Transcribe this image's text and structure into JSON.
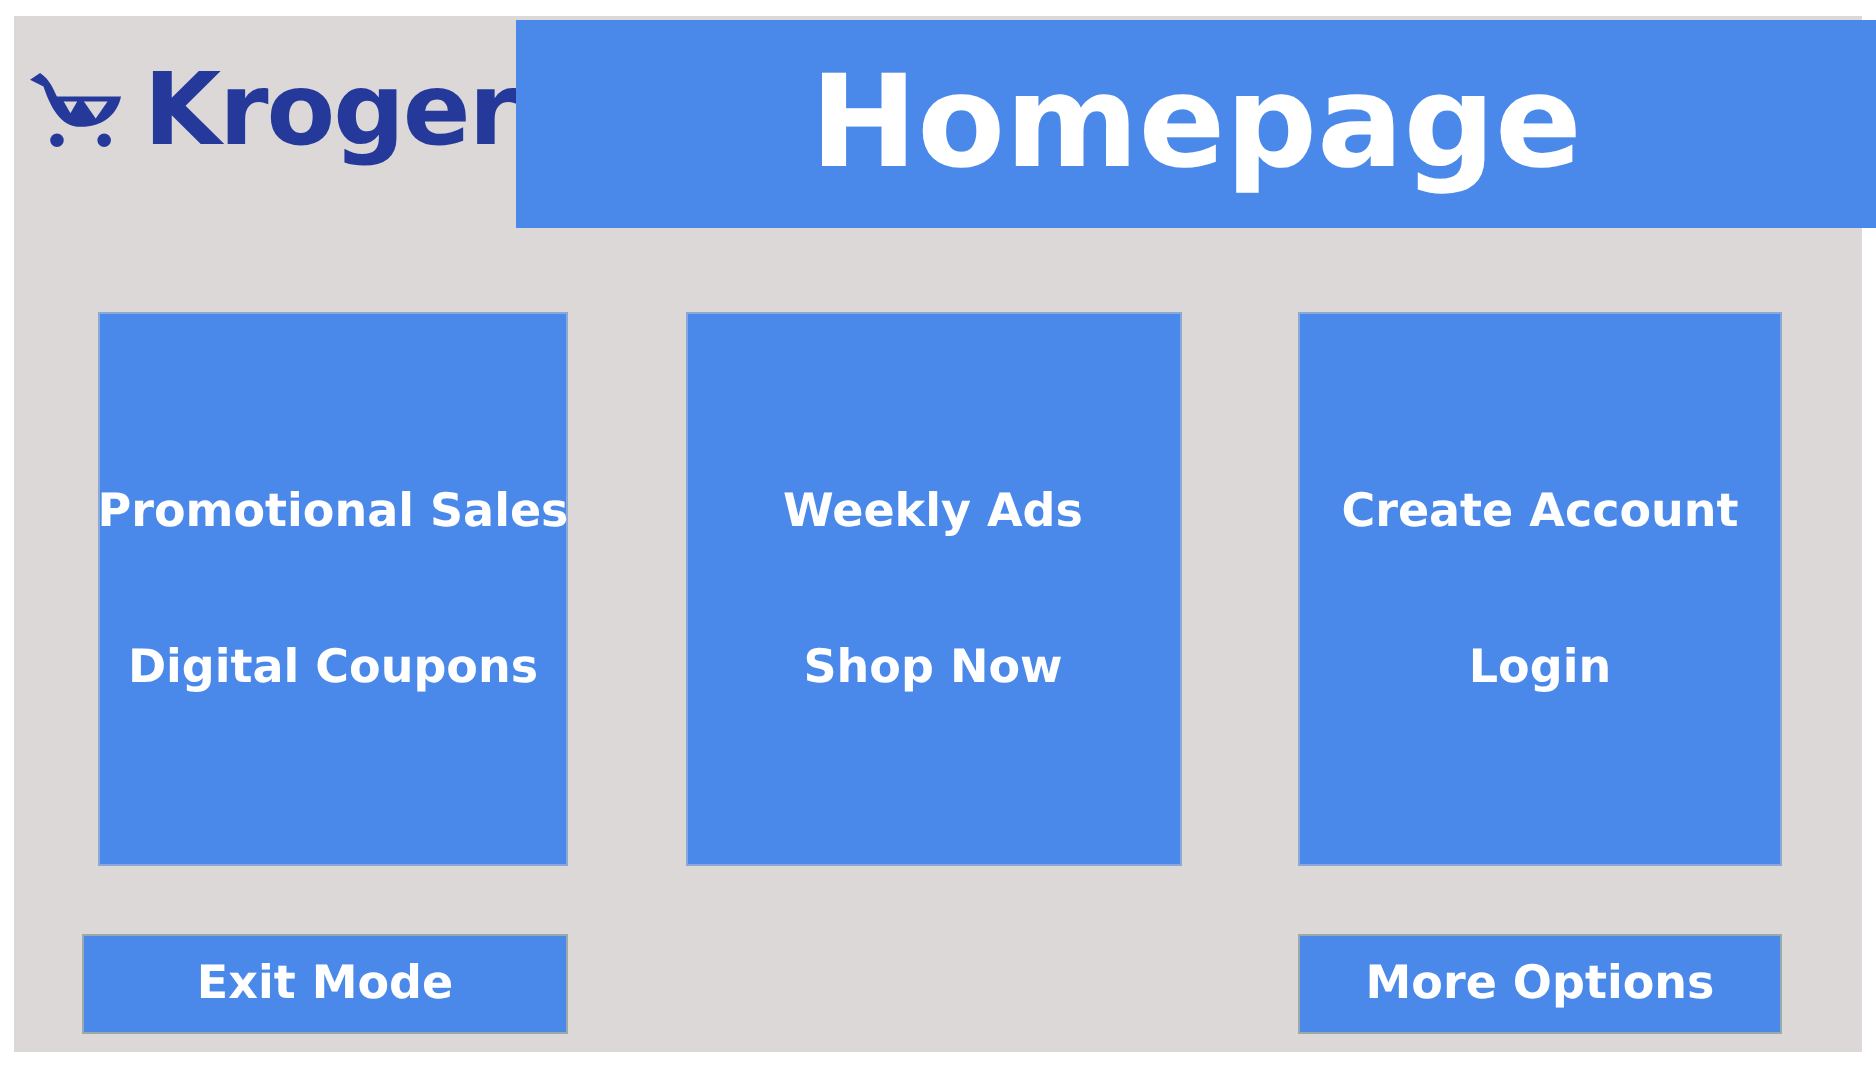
{
  "logo": {
    "text": "Kroger"
  },
  "header": {
    "title": "Homepage"
  },
  "cards": [
    {
      "links": [
        "Promotional Sales",
        "Digital Coupons"
      ]
    },
    {
      "links": [
        "Weekly Ads",
        "Shop Now"
      ]
    },
    {
      "links": [
        "Create Account",
        "Login"
      ]
    }
  ],
  "buttons": [
    "Exit Mode",
    "More Options"
  ]
}
